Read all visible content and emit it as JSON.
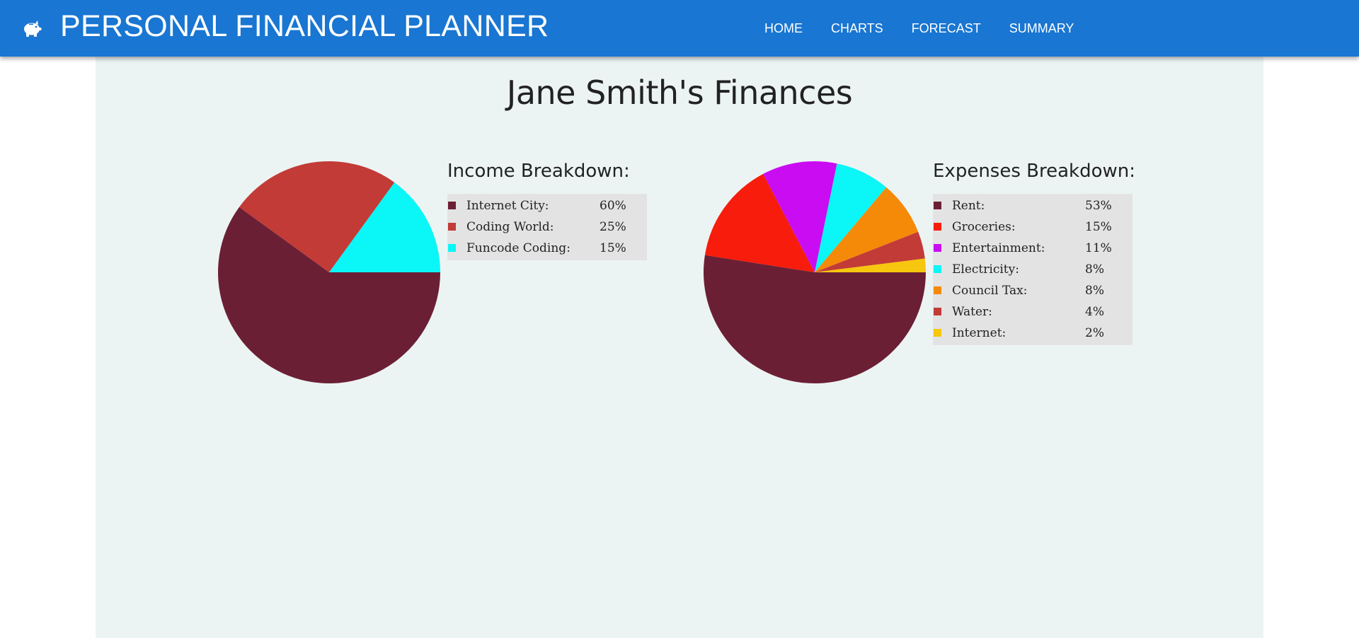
{
  "app": {
    "title": "PERSONAL FINANCIAL PLANNER",
    "logo_icon": "piggy-bank-icon",
    "header_color": "#1976d2"
  },
  "nav": {
    "items": [
      {
        "label": "HOME"
      },
      {
        "label": "CHARTS"
      },
      {
        "label": "FORECAST"
      },
      {
        "label": "SUMMARY"
      }
    ]
  },
  "page": {
    "title": "Jane Smith's Finances"
  },
  "chart_data": [
    {
      "type": "pie",
      "title": "Income Breakdown:",
      "legend_placement": "right",
      "slices": [
        {
          "label": "Internet City:",
          "value": 60,
          "display": "60%",
          "color": "#6b1f35"
        },
        {
          "label": "Coding World:",
          "value": 25,
          "display": "25%",
          "color": "#c23b37"
        },
        {
          "label": "Funcode Coding:",
          "value": 15,
          "display": "15%",
          "color": "#0bf6f6"
        }
      ]
    },
    {
      "type": "pie",
      "title": "Expenses Breakdown:",
      "legend_placement": "right",
      "slices": [
        {
          "label": "Rent:",
          "value": 53,
          "display": "53%",
          "color": "#6b1f35"
        },
        {
          "label": "Groceries:",
          "value": 15,
          "display": "15%",
          "color": "#f71c0c"
        },
        {
          "label": "Entertainment:",
          "value": 11,
          "display": "11%",
          "color": "#c90cf2"
        },
        {
          "label": "Electricity:",
          "value": 8,
          "display": "8%",
          "color": "#0bf6f6"
        },
        {
          "label": "Council Tax:",
          "value": 8,
          "display": "8%",
          "color": "#f58a08"
        },
        {
          "label": "Water:",
          "value": 4,
          "display": "4%",
          "color": "#c23b37"
        },
        {
          "label": "Internet:",
          "value": 2,
          "display": "2%",
          "color": "#f7c60e"
        }
      ]
    }
  ]
}
